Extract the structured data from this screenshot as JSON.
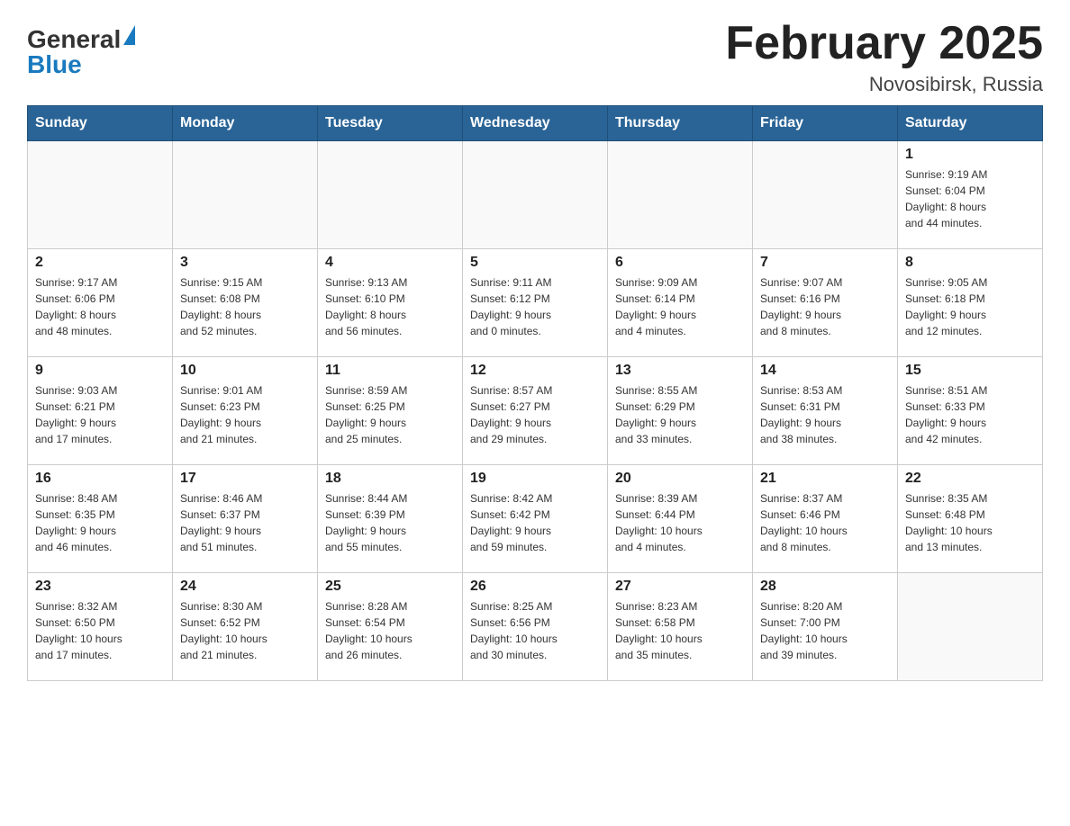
{
  "header": {
    "logo_general": "General",
    "logo_blue": "Blue",
    "month_title": "February 2025",
    "location": "Novosibirsk, Russia"
  },
  "weekdays": [
    "Sunday",
    "Monday",
    "Tuesday",
    "Wednesday",
    "Thursday",
    "Friday",
    "Saturday"
  ],
  "weeks": [
    [
      {
        "day": "",
        "info": ""
      },
      {
        "day": "",
        "info": ""
      },
      {
        "day": "",
        "info": ""
      },
      {
        "day": "",
        "info": ""
      },
      {
        "day": "",
        "info": ""
      },
      {
        "day": "",
        "info": ""
      },
      {
        "day": "1",
        "info": "Sunrise: 9:19 AM\nSunset: 6:04 PM\nDaylight: 8 hours\nand 44 minutes."
      }
    ],
    [
      {
        "day": "2",
        "info": "Sunrise: 9:17 AM\nSunset: 6:06 PM\nDaylight: 8 hours\nand 48 minutes."
      },
      {
        "day": "3",
        "info": "Sunrise: 9:15 AM\nSunset: 6:08 PM\nDaylight: 8 hours\nand 52 minutes."
      },
      {
        "day": "4",
        "info": "Sunrise: 9:13 AM\nSunset: 6:10 PM\nDaylight: 8 hours\nand 56 minutes."
      },
      {
        "day": "5",
        "info": "Sunrise: 9:11 AM\nSunset: 6:12 PM\nDaylight: 9 hours\nand 0 minutes."
      },
      {
        "day": "6",
        "info": "Sunrise: 9:09 AM\nSunset: 6:14 PM\nDaylight: 9 hours\nand 4 minutes."
      },
      {
        "day": "7",
        "info": "Sunrise: 9:07 AM\nSunset: 6:16 PM\nDaylight: 9 hours\nand 8 minutes."
      },
      {
        "day": "8",
        "info": "Sunrise: 9:05 AM\nSunset: 6:18 PM\nDaylight: 9 hours\nand 12 minutes."
      }
    ],
    [
      {
        "day": "9",
        "info": "Sunrise: 9:03 AM\nSunset: 6:21 PM\nDaylight: 9 hours\nand 17 minutes."
      },
      {
        "day": "10",
        "info": "Sunrise: 9:01 AM\nSunset: 6:23 PM\nDaylight: 9 hours\nand 21 minutes."
      },
      {
        "day": "11",
        "info": "Sunrise: 8:59 AM\nSunset: 6:25 PM\nDaylight: 9 hours\nand 25 minutes."
      },
      {
        "day": "12",
        "info": "Sunrise: 8:57 AM\nSunset: 6:27 PM\nDaylight: 9 hours\nand 29 minutes."
      },
      {
        "day": "13",
        "info": "Sunrise: 8:55 AM\nSunset: 6:29 PM\nDaylight: 9 hours\nand 33 minutes."
      },
      {
        "day": "14",
        "info": "Sunrise: 8:53 AM\nSunset: 6:31 PM\nDaylight: 9 hours\nand 38 minutes."
      },
      {
        "day": "15",
        "info": "Sunrise: 8:51 AM\nSunset: 6:33 PM\nDaylight: 9 hours\nand 42 minutes."
      }
    ],
    [
      {
        "day": "16",
        "info": "Sunrise: 8:48 AM\nSunset: 6:35 PM\nDaylight: 9 hours\nand 46 minutes."
      },
      {
        "day": "17",
        "info": "Sunrise: 8:46 AM\nSunset: 6:37 PM\nDaylight: 9 hours\nand 51 minutes."
      },
      {
        "day": "18",
        "info": "Sunrise: 8:44 AM\nSunset: 6:39 PM\nDaylight: 9 hours\nand 55 minutes."
      },
      {
        "day": "19",
        "info": "Sunrise: 8:42 AM\nSunset: 6:42 PM\nDaylight: 9 hours\nand 59 minutes."
      },
      {
        "day": "20",
        "info": "Sunrise: 8:39 AM\nSunset: 6:44 PM\nDaylight: 10 hours\nand 4 minutes."
      },
      {
        "day": "21",
        "info": "Sunrise: 8:37 AM\nSunset: 6:46 PM\nDaylight: 10 hours\nand 8 minutes."
      },
      {
        "day": "22",
        "info": "Sunrise: 8:35 AM\nSunset: 6:48 PM\nDaylight: 10 hours\nand 13 minutes."
      }
    ],
    [
      {
        "day": "23",
        "info": "Sunrise: 8:32 AM\nSunset: 6:50 PM\nDaylight: 10 hours\nand 17 minutes."
      },
      {
        "day": "24",
        "info": "Sunrise: 8:30 AM\nSunset: 6:52 PM\nDaylight: 10 hours\nand 21 minutes."
      },
      {
        "day": "25",
        "info": "Sunrise: 8:28 AM\nSunset: 6:54 PM\nDaylight: 10 hours\nand 26 minutes."
      },
      {
        "day": "26",
        "info": "Sunrise: 8:25 AM\nSunset: 6:56 PM\nDaylight: 10 hours\nand 30 minutes."
      },
      {
        "day": "27",
        "info": "Sunrise: 8:23 AM\nSunset: 6:58 PM\nDaylight: 10 hours\nand 35 minutes."
      },
      {
        "day": "28",
        "info": "Sunrise: 8:20 AM\nSunset: 7:00 PM\nDaylight: 10 hours\nand 39 minutes."
      },
      {
        "day": "",
        "info": ""
      }
    ]
  ]
}
